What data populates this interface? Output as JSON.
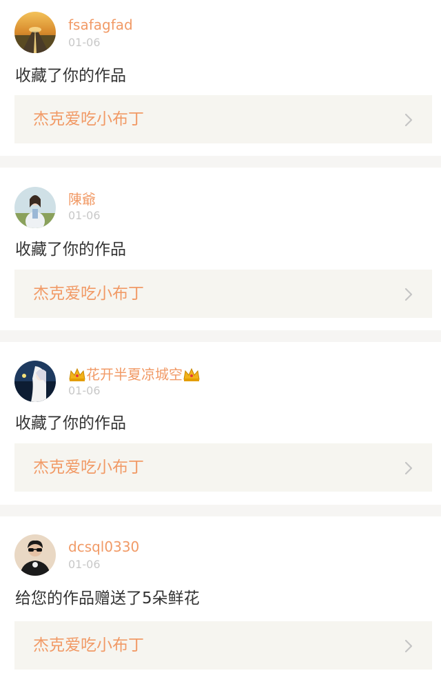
{
  "notifications": [
    {
      "username": "fsafagfad",
      "date": "01-06",
      "action": "收藏了你的作品",
      "work_title": "杰克爱吃小布丁",
      "avatar_icon": "landscape-road-avatar",
      "crowned": false
    },
    {
      "username": "陳爺",
      "date": "01-06",
      "action": "收藏了你的作品",
      "work_title": "杰克爱吃小布丁",
      "avatar_icon": "girl-portrait-avatar",
      "crowned": false
    },
    {
      "username": "花开半夏凉城空",
      "date": "01-06",
      "action": "收藏了你的作品",
      "work_title": "杰克爱吃小布丁",
      "avatar_icon": "anime-character-avatar",
      "crowned": true
    },
    {
      "username": "dcsql0330",
      "date": "01-06",
      "action": "给您的作品赠送了5朵鲜花",
      "work_title": "杰克爱吃小布丁",
      "avatar_icon": "man-sunglasses-avatar",
      "crowned": false
    }
  ],
  "colors": {
    "accent": "#f19a66",
    "action_text": "#333333",
    "date_text": "#c8c8c8",
    "link_bg": "#f6f5f0",
    "separator": "#f6f5f3"
  },
  "icons": {
    "crown": "crown-icon",
    "chevron": "chevron-right-icon"
  }
}
